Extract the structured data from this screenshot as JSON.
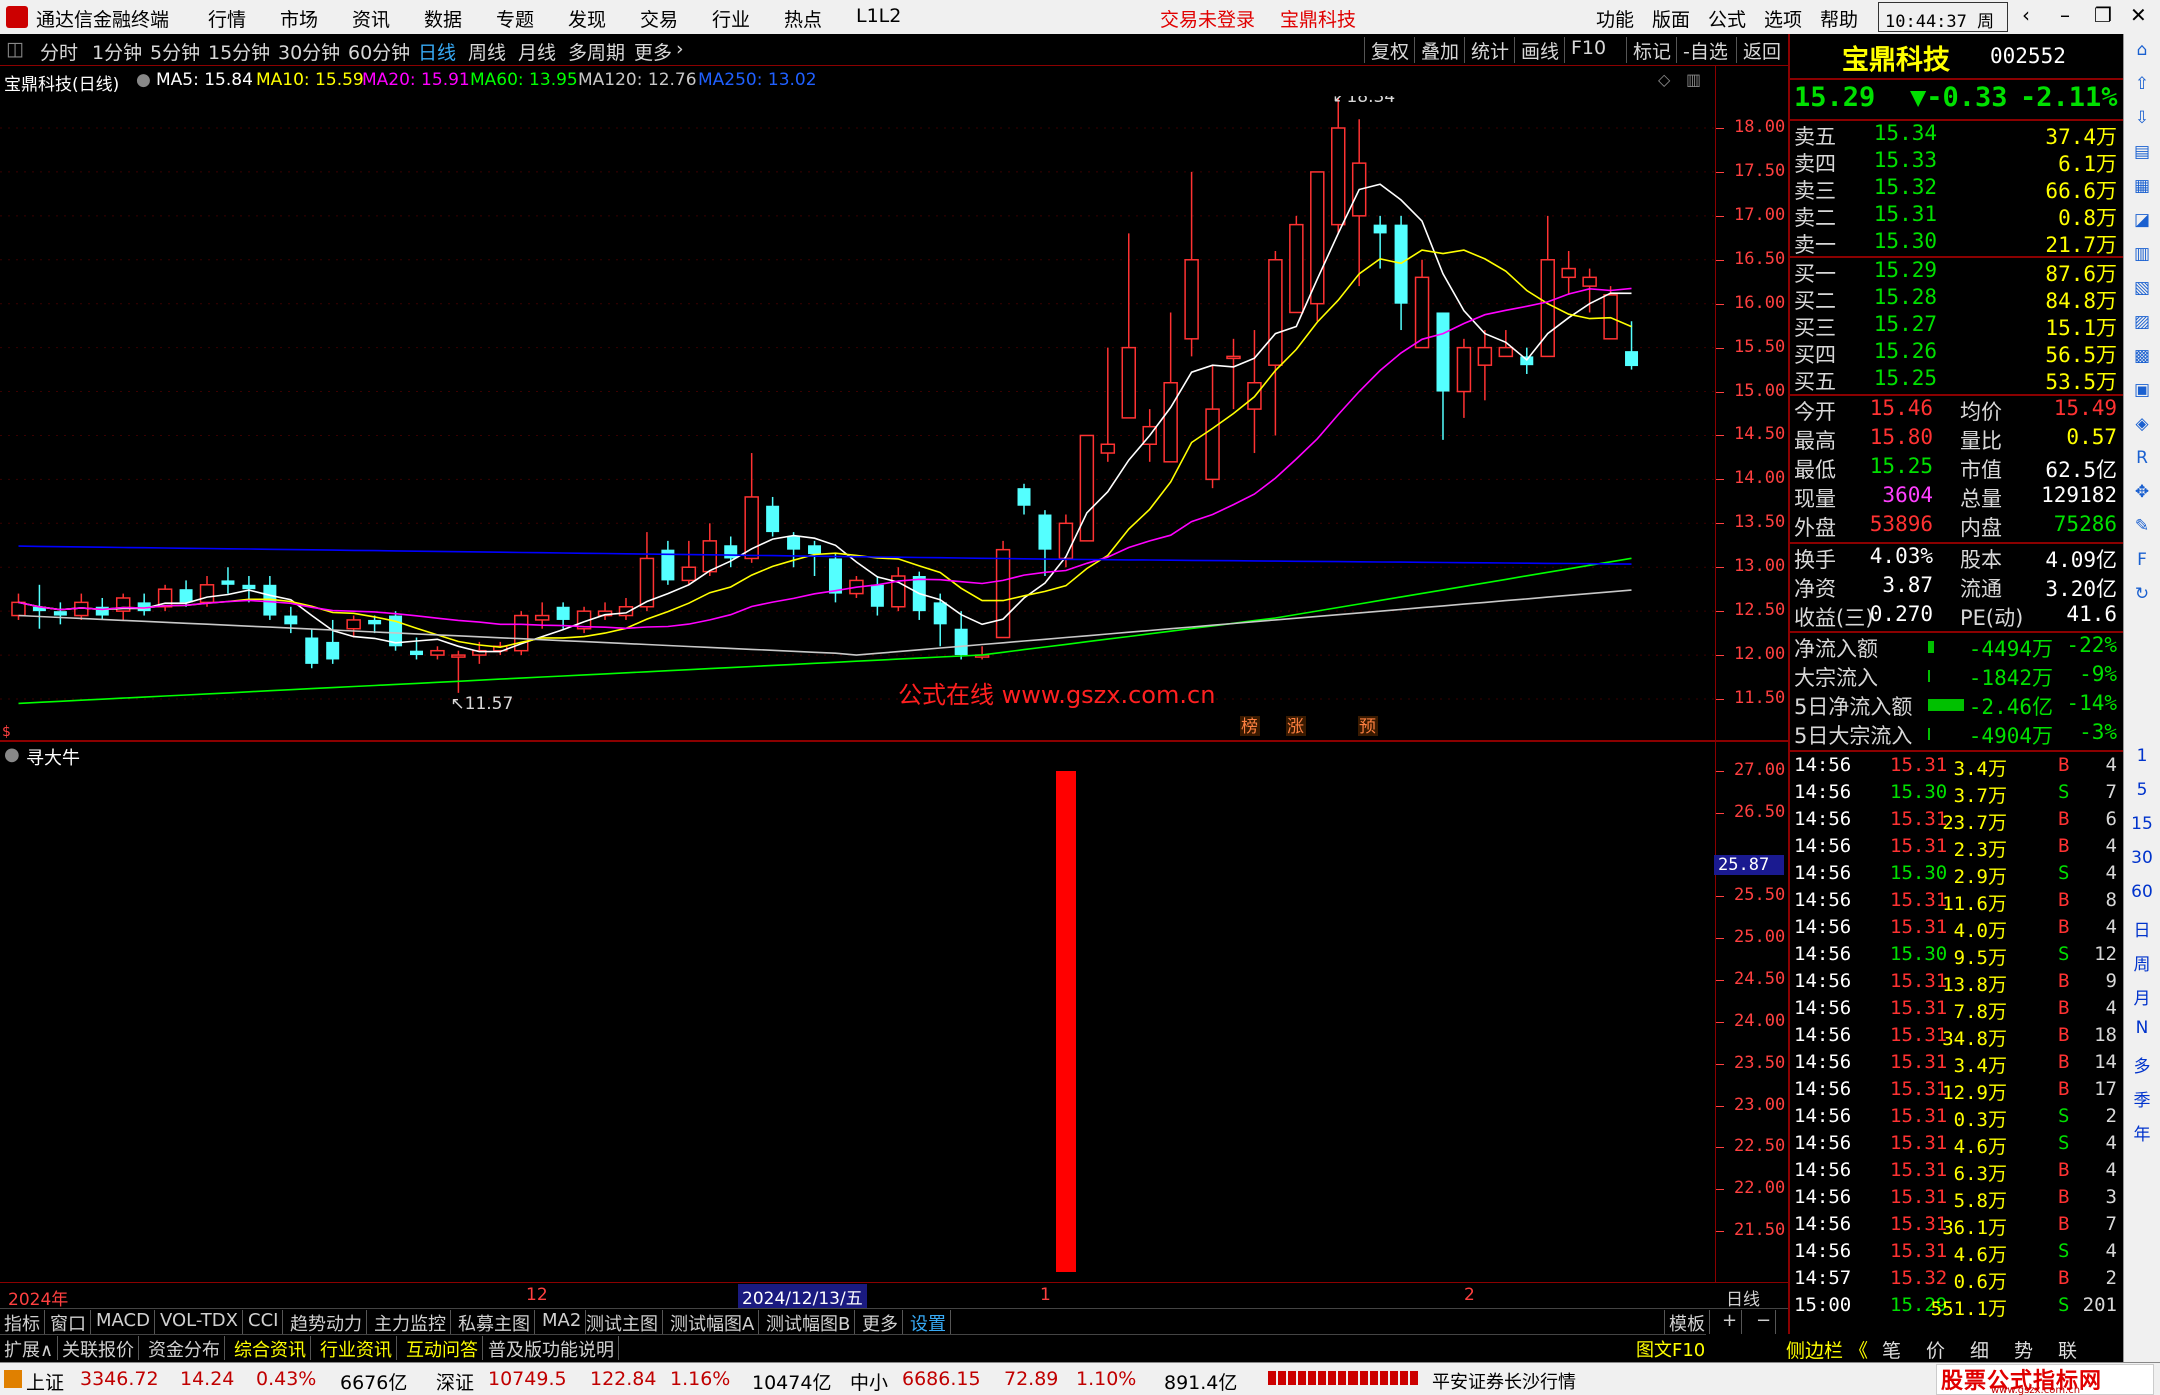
{
  "titlebar": {
    "app_title": "通达信金融终端",
    "menu": [
      "行情",
      "市场",
      "资讯",
      "数据",
      "专题",
      "发现",
      "交易",
      "行业",
      "热点",
      "L1L2"
    ],
    "trade_status": "交易未登录",
    "stock_name": "宝鼎科技",
    "right_menu": [
      "功能",
      "版面",
      "公式",
      "选项",
      "帮助"
    ],
    "time": "10:44:37",
    "weekday": "周日"
  },
  "periodbar": {
    "periods": [
      "分时",
      "1分钟",
      "5分钟",
      "15分钟",
      "30分钟",
      "60分钟",
      "日线",
      "周线",
      "月线",
      "多周期",
      "更多"
    ],
    "active_period": "日线",
    "tools": [
      "复权",
      "叠加",
      "统计",
      "画线",
      "F10",
      "标记",
      "-自选",
      "返回"
    ]
  },
  "mabar": {
    "title": "宝鼎科技(日线)",
    "items": [
      {
        "text": "MA5: 15.84",
        "color": "#ffffff"
      },
      {
        "text": "MA10: 15.59",
        "color": "#ffff00"
      },
      {
        "text": "MA20: 15.91",
        "color": "#ff00ff"
      },
      {
        "text": "MA60: 13.95",
        "color": "#00ff00"
      },
      {
        "text": "MA120: 12.76",
        "color": "#c8c8c8"
      },
      {
        "text": "MA250: 13.02",
        "color": "#0000ff"
      }
    ]
  },
  "price_axis": [
    "18.00",
    "17.50",
    "17.00",
    "16.50",
    "16.00",
    "15.50",
    "15.00",
    "14.50",
    "14.00",
    "13.50",
    "13.00",
    "12.50",
    "12.00",
    "11.50"
  ],
  "chart_data": [
    {
      "type": "candlestick",
      "title": "宝鼎科技(日线)",
      "annotations": {
        "high": "18.34",
        "low": "11.57",
        "watermark": "公式在线  www.gszx.com.cn",
        "markers": [
          "榜",
          "涨",
          "预"
        ]
      },
      "ylim": [
        11.2,
        18.6
      ],
      "candles": [
        [
          12.45,
          12.6,
          12.7,
          12.4
        ],
        [
          12.55,
          12.5,
          12.8,
          12.3
        ],
        [
          12.5,
          12.45,
          12.6,
          12.35
        ],
        [
          12.45,
          12.6,
          12.7,
          12.4
        ],
        [
          12.55,
          12.45,
          12.65,
          12.4
        ],
        [
          12.5,
          12.65,
          12.7,
          12.4
        ],
        [
          12.6,
          12.5,
          12.7,
          12.45
        ],
        [
          12.55,
          12.75,
          12.8,
          12.5
        ],
        [
          12.75,
          12.6,
          12.85,
          12.55
        ],
        [
          12.6,
          12.8,
          12.9,
          12.55
        ],
        [
          12.85,
          12.8,
          13.0,
          12.7
        ],
        [
          12.8,
          12.75,
          12.9,
          12.6
        ],
        [
          12.8,
          12.45,
          12.9,
          12.4
        ],
        [
          12.45,
          12.35,
          12.55,
          12.25
        ],
        [
          12.2,
          11.9,
          12.3,
          11.85
        ],
        [
          12.15,
          11.95,
          12.4,
          11.9
        ],
        [
          12.3,
          12.4,
          12.45,
          12.2
        ],
        [
          12.4,
          12.35,
          12.45,
          12.25
        ],
        [
          12.45,
          12.1,
          12.5,
          12.05
        ],
        [
          12.05,
          12.0,
          12.2,
          11.95
        ],
        [
          12.0,
          12.05,
          12.1,
          11.95
        ],
        [
          12.0,
          12.0,
          12.05,
          11.57
        ],
        [
          12.0,
          12.05,
          12.15,
          11.9
        ],
        [
          12.05,
          12.1,
          12.15,
          12.0
        ],
        [
          12.05,
          12.45,
          12.5,
          12.0
        ],
        [
          12.4,
          12.45,
          12.6,
          12.3
        ],
        [
          12.55,
          12.4,
          12.6,
          12.3
        ],
        [
          12.3,
          12.5,
          12.55,
          12.25
        ],
        [
          12.45,
          12.5,
          12.6,
          12.4
        ],
        [
          12.45,
          12.55,
          12.65,
          12.4
        ],
        [
          12.55,
          13.1,
          13.4,
          12.5
        ],
        [
          13.2,
          12.85,
          13.3,
          12.8
        ],
        [
          12.85,
          13.0,
          13.3,
          12.8
        ],
        [
          12.95,
          13.3,
          13.5,
          12.9
        ],
        [
          13.25,
          13.1,
          13.35,
          13.0
        ],
        [
          13.1,
          13.8,
          14.3,
          13.05
        ],
        [
          13.7,
          13.4,
          13.8,
          13.35
        ],
        [
          13.35,
          13.2,
          13.4,
          13.0
        ],
        [
          13.25,
          13.15,
          13.3,
          12.9
        ],
        [
          13.1,
          12.7,
          13.15,
          12.6
        ],
        [
          12.7,
          12.85,
          12.9,
          12.65
        ],
        [
          12.8,
          12.55,
          12.9,
          12.45
        ],
        [
          12.55,
          12.9,
          13.0,
          12.5
        ],
        [
          12.9,
          12.5,
          12.95,
          12.4
        ],
        [
          12.6,
          12.35,
          12.7,
          12.1
        ],
        [
          12.3,
          12.0,
          12.5,
          11.95
        ],
        [
          12.0,
          12.0,
          12.1,
          11.95
        ],
        [
          12.2,
          13.2,
          13.3,
          12.2
        ],
        [
          13.9,
          13.7,
          13.95,
          13.6
        ],
        [
          13.6,
          13.2,
          13.65,
          12.9
        ],
        [
          13.1,
          13.5,
          13.6,
          13.0
        ],
        [
          13.3,
          14.5,
          14.5,
          13.3
        ],
        [
          14.3,
          14.4,
          15.5,
          14.2
        ],
        [
          14.7,
          15.5,
          16.8,
          14.7
        ],
        [
          14.4,
          14.6,
          14.8,
          14.2
        ],
        [
          14.2,
          15.1,
          15.9,
          14.2
        ],
        [
          15.6,
          16.5,
          17.5,
          15.4
        ],
        [
          14.0,
          14.8,
          15.3,
          13.9
        ],
        [
          15.4,
          15.4,
          15.6,
          14.8
        ],
        [
          14.8,
          15.1,
          15.7,
          14.3
        ],
        [
          15.3,
          16.5,
          16.6,
          14.5
        ],
        [
          15.9,
          16.9,
          17.0,
          15.9
        ],
        [
          16.0,
          17.5,
          17.5,
          15.8
        ],
        [
          16.9,
          18.0,
          18.34,
          16.8
        ],
        [
          17.0,
          17.6,
          18.1,
          16.2
        ],
        [
          16.9,
          16.8,
          17.0,
          16.4
        ],
        [
          16.9,
          16.0,
          17.0,
          15.7
        ],
        [
          15.5,
          16.3,
          16.5,
          15.5
        ],
        [
          15.9,
          15.0,
          15.9,
          14.45
        ],
        [
          15.0,
          15.5,
          15.6,
          14.7
        ],
        [
          15.3,
          15.5,
          15.7,
          14.9
        ],
        [
          15.4,
          15.5,
          15.7,
          15.4
        ],
        [
          15.4,
          15.3,
          15.5,
          15.2
        ],
        [
          15.4,
          16.5,
          17.0,
          15.4
        ],
        [
          16.3,
          16.4,
          16.6,
          16.1
        ],
        [
          16.2,
          16.3,
          16.4,
          15.9
        ],
        [
          15.6,
          16.1,
          16.2,
          15.6
        ],
        [
          15.46,
          15.29,
          15.8,
          15.25
        ]
      ],
      "ma": {
        "MA5": {
          "color": "#ffffff"
        },
        "MA10": {
          "color": "#ffff00"
        },
        "MA20": {
          "color": "#ff00ff"
        },
        "MA60": {
          "color": "#00ff00"
        },
        "MA120": {
          "color": "#c8c8c8"
        },
        "MA250": {
          "color": "#0000ff"
        }
      }
    },
    {
      "type": "bar",
      "title": "寻大牛",
      "ylim": [
        21.0,
        27.3
      ],
      "current_value_label": "25.87",
      "y_ticks": [
        "27.00",
        "26.50",
        "25.50",
        "25.00",
        "24.50",
        "24.00",
        "23.50",
        "23.00",
        "22.50",
        "22.00",
        "21.50"
      ],
      "bars": [
        {
          "index": 52,
          "value": 27.0,
          "color": "#ff0000"
        }
      ]
    }
  ],
  "indicator": {
    "name": "寻大牛",
    "current_value": "25.87"
  },
  "date_axis": {
    "labels": [
      "2024年",
      "12",
      "2024/12/13/五",
      "1",
      "2"
    ],
    "period_label": "日线"
  },
  "tabbar": {
    "tabs": [
      "指标",
      "窗口",
      "MACD",
      "VOL-TDX",
      "CCI",
      "趋势动力",
      "主力监控",
      "私募主图",
      "MA2",
      "测试主图",
      "测试幅图A",
      "测试幅图B",
      "更多",
      "设置"
    ],
    "right": [
      "模板",
      "+",
      "−"
    ]
  },
  "bottombar2": {
    "items": [
      "扩展∧",
      "关联报价",
      "资金分布",
      "综合资讯",
      "行业资讯",
      "互动问答",
      "普及版功能说明"
    ],
    "right": [
      "图文F10",
      "侧边栏 《",
      "笔",
      "价",
      "细",
      "势",
      "联"
    ]
  },
  "statusbar": {
    "sh": {
      "label": "上证",
      "value": "3346.72",
      "chg": "14.24",
      "pct": "0.43%",
      "amt": "6676亿"
    },
    "sz": {
      "label": "深证",
      "value": "10749.5",
      "chg": "122.84",
      "pct": "1.16%",
      "amt": "10474亿"
    },
    "zx": {
      "label": "中小",
      "value": "6686.15",
      "chg": "72.89",
      "pct": "1.10%",
      "amt": "891.4亿"
    },
    "broker": "平安证券长沙行情",
    "brand": "股票公式指标网",
    "brand_url": "www.gszx.com.cn"
  },
  "quote": {
    "name": "宝鼎科技",
    "code": "002552",
    "price": "15.29",
    "change": "▼-0.33",
    "pct": "-2.11%",
    "asks": [
      {
        "label": "卖五",
        "price": "15.34",
        "vol": "37.4万"
      },
      {
        "label": "卖四",
        "price": "15.33",
        "vol": "6.1万"
      },
      {
        "label": "卖三",
        "price": "15.32",
        "vol": "66.6万"
      },
      {
        "label": "卖二",
        "price": "15.31",
        "vol": "0.8万"
      },
      {
        "label": "卖一",
        "price": "15.30",
        "vol": "21.7万"
      }
    ],
    "bids": [
      {
        "label": "买一",
        "price": "15.29",
        "vol": "87.6万"
      },
      {
        "label": "买二",
        "price": "15.28",
        "vol": "84.8万"
      },
      {
        "label": "买三",
        "price": "15.27",
        "vol": "15.1万"
      },
      {
        "label": "买四",
        "price": "15.26",
        "vol": "56.5万"
      },
      {
        "label": "买五",
        "price": "15.25",
        "vol": "53.5万"
      }
    ],
    "stats": [
      {
        "l1": "今开",
        "v1": "15.46",
        "c1": "red",
        "l2": "均价",
        "v2": "15.49",
        "c2": "red"
      },
      {
        "l1": "最高",
        "v1": "15.80",
        "c1": "red",
        "l2": "量比",
        "v2": "0.57",
        "c2": "yellow"
      },
      {
        "l1": "最低",
        "v1": "15.25",
        "c1": "green",
        "l2": "市值",
        "v2": "62.5亿",
        "c2": "white"
      },
      {
        "l1": "现量",
        "v1": "3604",
        "c1": "magenta",
        "l2": "总量",
        "v2": "129182",
        "c2": "white"
      },
      {
        "l1": "外盘",
        "v1": "53896",
        "c1": "red",
        "l2": "内盘",
        "v2": "75286",
        "c2": "green"
      }
    ],
    "fund": [
      {
        "l1": "换手",
        "v1": "4.03%",
        "l2": "股本",
        "v2": "4.09亿"
      },
      {
        "l1": "净资",
        "v1": "3.87",
        "l2": "流通",
        "v2": "3.20亿"
      },
      {
        "l1": "收益(三)",
        "v1": "0.270",
        "l2": "PE(动)",
        "v2": "41.6"
      }
    ],
    "flow": [
      {
        "label": "净流入额",
        "val": "-4494万",
        "pct": "-22%"
      },
      {
        "label": "大宗流入",
        "val": "-1842万",
        "pct": "-9%"
      },
      {
        "label": "5日净流入额",
        "val": "-2.46亿",
        "pct": "-14%"
      },
      {
        "label": "5日大宗流入",
        "val": "-4904万",
        "pct": "-3%"
      }
    ],
    "ticks": [
      {
        "t": "14:56",
        "p": "15.31",
        "v": "3.4万",
        "d": "B",
        "n": "4"
      },
      {
        "t": "14:56",
        "p": "15.30",
        "v": "3.7万",
        "d": "S",
        "n": "7"
      },
      {
        "t": "14:56",
        "p": "15.31",
        "v": "23.7万",
        "d": "B",
        "n": "6"
      },
      {
        "t": "14:56",
        "p": "15.31",
        "v": "2.3万",
        "d": "B",
        "n": "4"
      },
      {
        "t": "14:56",
        "p": "15.30",
        "v": "2.9万",
        "d": "S",
        "n": "4"
      },
      {
        "t": "14:56",
        "p": "15.31",
        "v": "11.6万",
        "d": "B",
        "n": "8"
      },
      {
        "t": "14:56",
        "p": "15.31",
        "v": "4.0万",
        "d": "B",
        "n": "4"
      },
      {
        "t": "14:56",
        "p": "15.30",
        "v": "9.5万",
        "d": "S",
        "n": "12"
      },
      {
        "t": "14:56",
        "p": "15.31",
        "v": "13.8万",
        "d": "B",
        "n": "9"
      },
      {
        "t": "14:56",
        "p": "15.31",
        "v": "7.8万",
        "d": "B",
        "n": "4"
      },
      {
        "t": "14:56",
        "p": "15.31",
        "v": "34.8万",
        "d": "B",
        "n": "18"
      },
      {
        "t": "14:56",
        "p": "15.31",
        "v": "3.4万",
        "d": "B",
        "n": "14"
      },
      {
        "t": "14:56",
        "p": "15.31",
        "v": "12.9万",
        "d": "B",
        "n": "17"
      },
      {
        "t": "14:56",
        "p": "15.31",
        "v": "0.3万",
        "d": "S",
        "n": "2"
      },
      {
        "t": "14:56",
        "p": "15.31",
        "v": "4.6万",
        "d": "S",
        "n": "4"
      },
      {
        "t": "14:56",
        "p": "15.31",
        "v": "6.3万",
        "d": "B",
        "n": "4"
      },
      {
        "t": "14:56",
        "p": "15.31",
        "v": "5.8万",
        "d": "B",
        "n": "3"
      },
      {
        "t": "14:56",
        "p": "15.31",
        "v": "36.1万",
        "d": "B",
        "n": "7"
      },
      {
        "t": "14:56",
        "p": "15.31",
        "v": "4.6万",
        "d": "S",
        "n": "4"
      },
      {
        "t": "14:57",
        "p": "15.32",
        "v": "0.6万",
        "d": "B",
        "n": "2"
      },
      {
        "t": "15:00",
        "p": "15.29",
        "v": "551.1万",
        "d": "S",
        "n": "201"
      }
    ]
  },
  "sidetool": [
    "1",
    "5",
    "15",
    "30",
    "60",
    "日",
    "周",
    "月",
    "N",
    "多",
    "季",
    "年"
  ]
}
